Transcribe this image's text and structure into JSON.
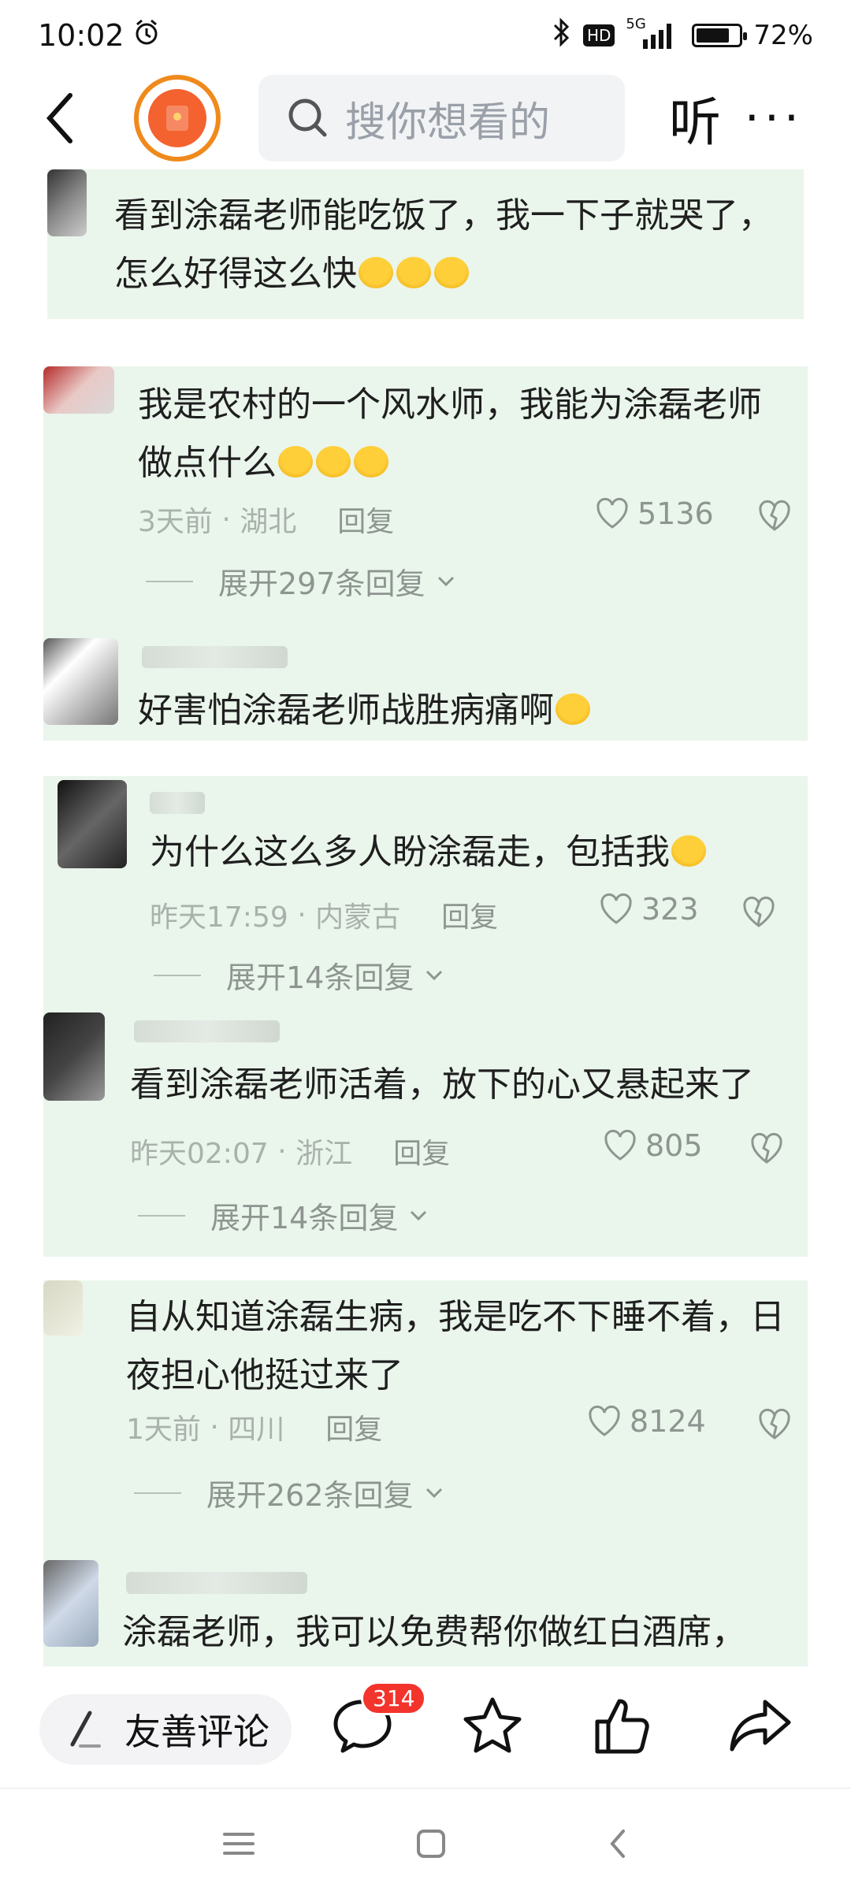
{
  "status": {
    "time": "10:02",
    "network": "5G",
    "hd": "HD",
    "battery": "72%",
    "battery_level": 0.72
  },
  "nav": {
    "search_placeholder": "搜你想看的",
    "listen_label": "听"
  },
  "comments": [
    {
      "text": "看到涂磊老师能吃饭了，我一下子就哭了，怎么好得这么快",
      "emoji_count": 3
    },
    {
      "text": "我是农村的一个风水师，我能为涂磊老师做点什么",
      "emoji_count": 3,
      "time": "3天前",
      "location": "湖北",
      "reply": "回复",
      "likes": "5136",
      "expand": "展开297条回复"
    },
    {
      "text": "好害怕涂磊老师战胜病痛啊",
      "emoji_count": 1
    },
    {
      "text": "为什么这么多人盼涂磊走，包括我",
      "emoji_count": 1,
      "time": "昨天17:59",
      "location": "内蒙古",
      "reply": "回复",
      "likes": "323",
      "expand": "展开14条回复"
    },
    {
      "text": "看到涂磊老师活着，放下的心又悬起来了",
      "time": "昨天02:07",
      "location": "浙江",
      "reply": "回复",
      "likes": "805",
      "expand": "展开14条回复"
    },
    {
      "text": "自从知道涂磊生病，我是吃不下睡不着，日夜担心他挺过来了",
      "time": "1天前",
      "location": "四川",
      "reply": "回复",
      "likes": "8124",
      "expand": "展开262条回复"
    },
    {
      "text": "涂磊老师，我可以免费帮你做红白酒席，"
    }
  ],
  "bottom": {
    "comment_label": "友善评论",
    "comment_count": "314"
  }
}
